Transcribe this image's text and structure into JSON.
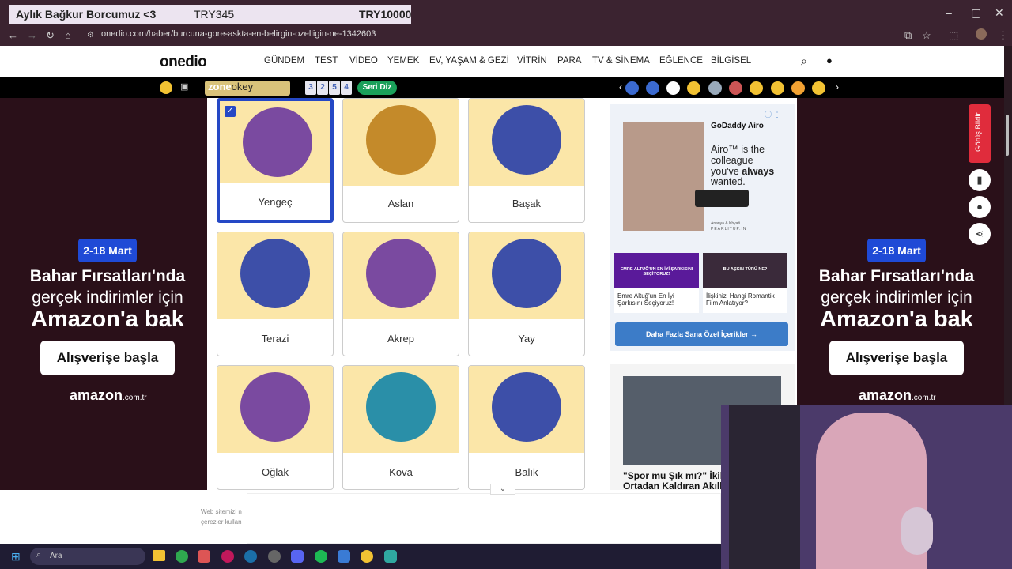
{
  "overlay": {
    "title": "Aylık Bağkur Borcumuz <3",
    "current": "TRY345",
    "goal": "TRY10000"
  },
  "browser": {
    "url": "onedio.com/haber/burcuna-gore-askta-en-belirgin-ozelligin-ne-1342603"
  },
  "site": {
    "logo": "onedio",
    "nav": [
      "GÜNDEM",
      "TEST",
      "VİDEO",
      "YEMEK",
      "EV, YAŞAM & GEZİ",
      "VİTRİN",
      "PARA",
      "TV & SİNEMA",
      "EĞLENCE",
      "BİLGİSEL"
    ],
    "zone_label": "zone",
    "zone_sub": "okey",
    "zone_tiles": [
      "3",
      "2",
      "5",
      "4"
    ],
    "seri_label": "Seri Diz"
  },
  "side_ad": {
    "date": "2-18 Mart",
    "line1": "Bahar Fırsatları'nda",
    "line2": "gerçek indirimler için",
    "line3": "Amazon'a bak",
    "button": "Alışverişe başla",
    "brand": "amazon",
    "brand_suffix": ".com.tr"
  },
  "signs": [
    {
      "name": "Yengeç",
      "icon": "cancer-icon",
      "selected": true,
      "color": "#b0324a"
    },
    {
      "name": "Aslan",
      "icon": "leo-icon",
      "selected": false,
      "color": "#c48a2a"
    },
    {
      "name": "Başak",
      "icon": "virgo-icon",
      "selected": false,
      "color": "#3d4fa8"
    },
    {
      "name": "Terazi",
      "icon": "libra-icon",
      "selected": false,
      "color": "#3d4fa8"
    },
    {
      "name": "Akrep",
      "icon": "scorpio-icon",
      "selected": false,
      "color": "#7a4aa0"
    },
    {
      "name": "Yay",
      "icon": "sagittarius-icon",
      "selected": false,
      "color": "#3d4fa8"
    },
    {
      "name": "Oğlak",
      "icon": "capricorn-icon",
      "selected": false,
      "color": "#7a4aa0"
    },
    {
      "name": "Kova",
      "icon": "aquarius-icon",
      "selected": false,
      "color": "#2a8fa8"
    },
    {
      "name": "Balık",
      "icon": "pisces-icon",
      "selected": false,
      "color": "#3d4fa8"
    }
  ],
  "right_ad": {
    "brand": "GoDaddy Airo",
    "text1": "Airo™ is the",
    "text2": "colleague",
    "text3": "you've",
    "text3b": "always",
    "text4": "wanted.",
    "credit1": "Ananya & Khyati",
    "credit2": "PEARLITUP.IN"
  },
  "related": [
    {
      "title": "Emre Altuğ'un En İyi Şarkısını Seçiyoruz!",
      "banner": "EMRE ALTUĞ'UN EN İYİ ŞARKISINI SEÇİYORUZ!"
    },
    {
      "title": "İlişkinizi Hangi Romantik Film Anlatıyor?",
      "banner": "BU AŞKIN TÜRÜ NE?"
    }
  ],
  "promo_button": "Daha Fazla Sana Özel İçerikler",
  "article": {
    "title1": "\"Spor mu Şık mı?\" İkile",
    "title2": "Ortadan Kaldıran Akıllı"
  },
  "cookie": {
    "line1": "Web sitemizi n",
    "line2": "çerezler kullan"
  },
  "feedback_label": "Görüş Bildir",
  "taskbar": {
    "search": "Ara"
  },
  "colors": {
    "accent": "#2548c5",
    "feedback": "#e02c3c",
    "promo": "#3c7cc8"
  }
}
